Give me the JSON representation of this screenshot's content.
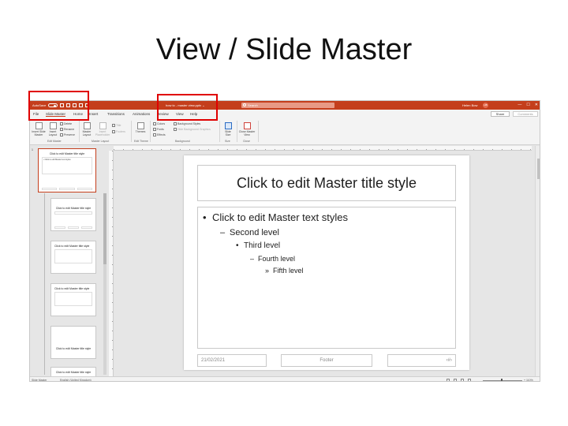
{
  "page": {
    "title": "View / Slide Master"
  },
  "titlebar": {
    "autosave": "AutoSave",
    "toggle_state": "On",
    "doc_name": "how to - master view.pptx ⌄",
    "search_placeholder": "Search",
    "user": "Helen Bow",
    "initials": "HB",
    "controls": [
      "—",
      "☐",
      "✕"
    ]
  },
  "tabs": {
    "items": [
      "File",
      "Slide Master",
      "Home",
      "Insert",
      "Transitions",
      "Animations",
      "Review",
      "View",
      "Help"
    ],
    "share": "Share",
    "comments": "Comments"
  },
  "ribbon": {
    "insert_slide_master": "Insert Slide Master",
    "insert_layout": "Insert Layout",
    "rename": "Rename",
    "preserve": "Preserve",
    "delete": "Delete",
    "master_layout": "Master Layout",
    "insert_placeholder": "Insert Placeholder",
    "title_check": "Title",
    "footers_check": "Footers",
    "themes": "Themes",
    "colors": "Colors",
    "fonts": "Fonts",
    "effects": "Effects",
    "background_styles": "Background Styles",
    "hide_background": "Hide Background Graphics",
    "slide_size": "Slide Size",
    "close_master_view": "Close Master View",
    "groups": {
      "edit_master": "Edit Master",
      "master_layout": "Master Layout",
      "edit_theme": "Edit Theme",
      "background": "Background",
      "size": "Size",
      "close": "Close"
    }
  },
  "thumbnails": {
    "number": "1",
    "master_title": "Click to edit Master title style",
    "master_body": "• Click to edit Master text styles",
    "layout_titles": [
      "Click to edit Master title style",
      "Click to edit Master title style",
      "Click to edit Master title style",
      "Click to edit Master title style",
      "Click to edit Master title style"
    ]
  },
  "slide": {
    "title": "Click to edit Master title style",
    "levels": [
      "Click to edit Master text styles",
      "Second level",
      "Third level",
      "Fourth level",
      "Fifth level"
    ],
    "footer_date": "21/02/2021",
    "footer_center": "Footer",
    "footer_number": "‹#›"
  },
  "status": {
    "view": "Slide Master",
    "language": "English (United Kingdom)",
    "zoom": "+ 110%"
  },
  "colors": {
    "accent": "#c43e1c",
    "highlight": "#e00000"
  }
}
